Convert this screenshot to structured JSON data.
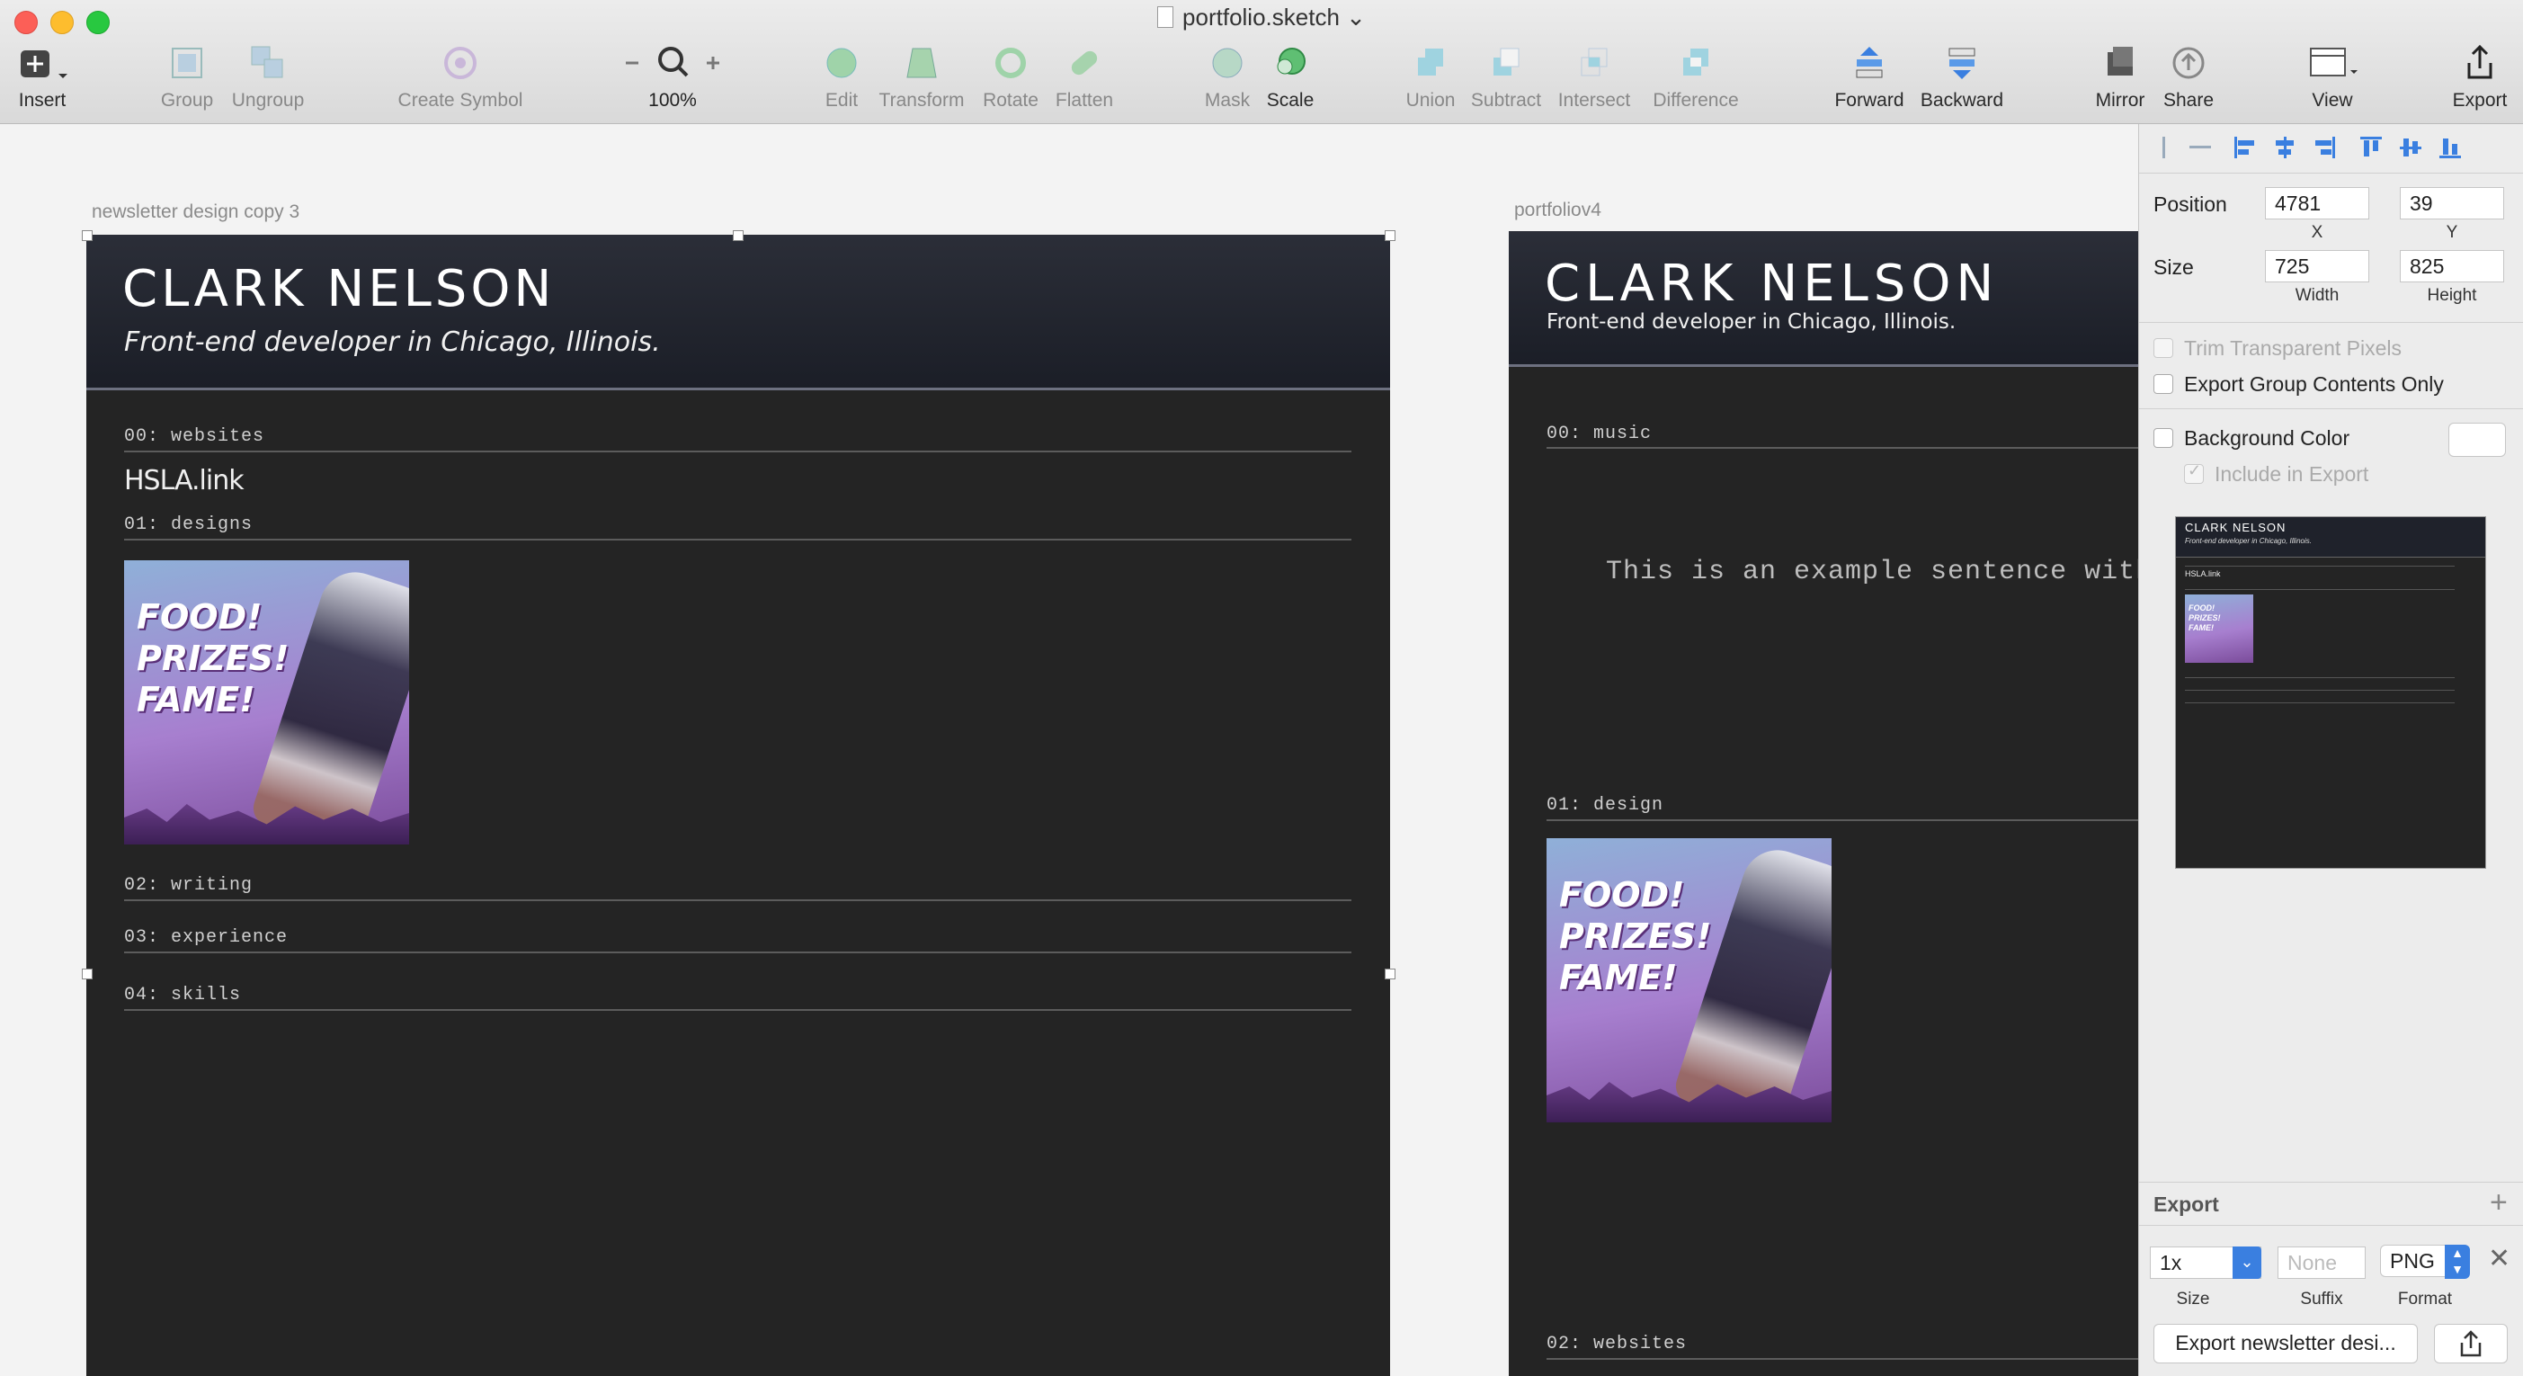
{
  "window": {
    "title": "portfolio.sketch"
  },
  "toolbar": {
    "insert": "Insert",
    "group": "Group",
    "ungroup": "Ungroup",
    "create_symbol": "Create Symbol",
    "zoom_level": "100%",
    "edit": "Edit",
    "transform": "Transform",
    "rotate": "Rotate",
    "flatten": "Flatten",
    "mask": "Mask",
    "scale": "Scale",
    "union": "Union",
    "subtract": "Subtract",
    "intersect": "Intersect",
    "difference": "Difference",
    "forward": "Forward",
    "backward": "Backward",
    "mirror": "Mirror",
    "share": "Share",
    "view": "View",
    "export": "Export"
  },
  "artboard1": {
    "label": "newsletter design copy 3",
    "name": "CLARK NELSON",
    "tagline": "Front-end developer in Chicago, Illinois.",
    "sections": [
      "00: websites",
      "01: designs",
      "02: writing",
      "03: experience",
      "04: skills"
    ],
    "link": "HSLA.link",
    "poster_text": [
      "FOOD!",
      "PRIZES!",
      "FAME!"
    ]
  },
  "artboard2": {
    "label": "portfoliov4",
    "name": "CLARK NELSON",
    "tagline": "Front-end developer in Chicago, Illinois.",
    "sections": [
      "00: music",
      "01: design",
      "02: websites"
    ],
    "sentence": "This is an example sentence with a",
    "poster_text": [
      "FOOD!",
      "PRIZES!",
      "FAME!"
    ]
  },
  "inspector": {
    "position_label": "Position",
    "x": "4781",
    "y": "39",
    "x_caption": "X",
    "y_caption": "Y",
    "size_label": "Size",
    "width": "725",
    "height": "825",
    "width_caption": "Width",
    "height_caption": "Height",
    "trim": "Trim Transparent Pixels",
    "export_group": "Export Group Contents Only",
    "background_color": "Background Color",
    "include_export": "Include in Export",
    "preview": {
      "name": "CLARK NELSON",
      "tagline": "Front-end developer in Chicago, Illinois.",
      "link": "HSLA.link",
      "poster_text": [
        "FOOD!",
        "PRIZES!",
        "FAME!"
      ]
    },
    "export_title": "Export",
    "export_size": "1x",
    "export_suffix_placeholder": "None",
    "export_format": "PNG",
    "size_caption": "Size",
    "suffix_caption": "Suffix",
    "format_caption": "Format",
    "export_button": "Export newsletter desi..."
  },
  "colors": {
    "accent": "#3a7fe0",
    "artboard_bg": "#242424",
    "header_bg": "#1f222b"
  }
}
